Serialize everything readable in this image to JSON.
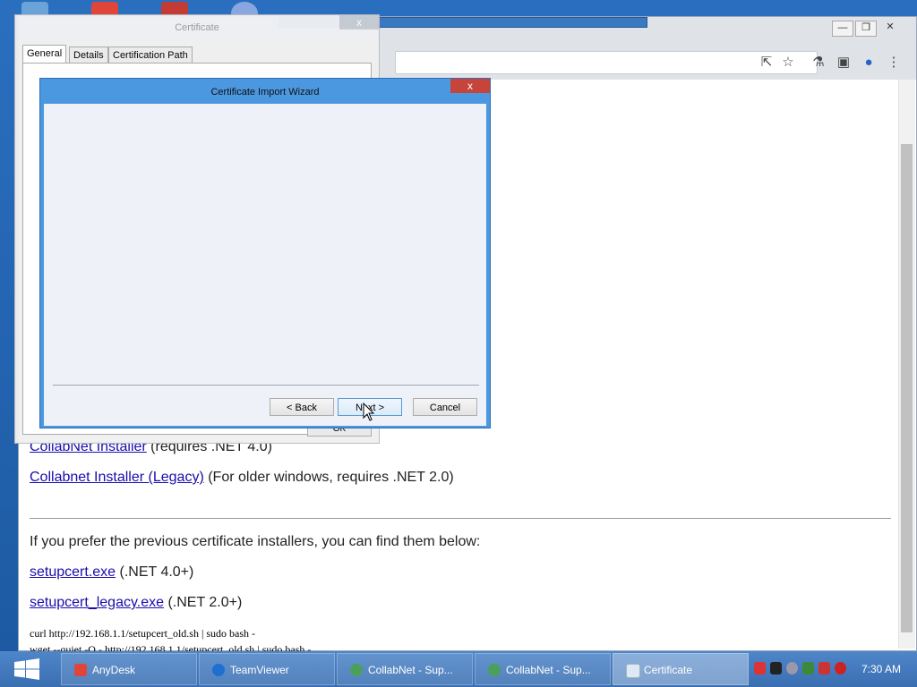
{
  "taskbar": {
    "items": [
      {
        "label": "AnyDesk"
      },
      {
        "label": "TeamViewer"
      },
      {
        "label": "CollabNet - Sup..."
      },
      {
        "label": "CollabNet - Sup..."
      },
      {
        "label": "Certificate"
      }
    ],
    "clock": "7:30 AM"
  },
  "certificate_dialog": {
    "title": "Certificate",
    "close": "x",
    "tabs": [
      "General",
      "Details",
      "Certification Path"
    ],
    "ok_label": "OK"
  },
  "wizard": {
    "title": "Certificate Import Wizard",
    "close": "x",
    "back_label": "< Back",
    "next_label": "Next >",
    "cancel_label": "Cancel"
  },
  "browser": {
    "window_controls": {
      "minimize": "—",
      "restore": "❐",
      "close": "✕"
    }
  },
  "page": {
    "installer_link": "CollabNet Installer",
    "installer_note": " (requires .NET 4.0)",
    "legacy_link": "Collabnet Installer (Legacy)",
    "legacy_note": " (For older windows, requires .NET 2.0)",
    "previous_text": "If you prefer the previous certificate installers, you can find them below:",
    "setupcert_link": "setupcert.exe",
    "setupcert_note": " (.NET 4.0+)",
    "setupcert_legacy_link": "setupcert_legacy.exe",
    "setupcert_legacy_note": " (.NET 2.0+)",
    "curl_cmd": "curl http://192.168.1.1/setupcert_old.sh | sudo bash -",
    "wget_cmd": "wget --quiet -O - http://192.168.1.1/setupcert_old.sh | sudo bash -"
  },
  "colors": {
    "link": "#1a0dab",
    "wizard_frame": "#4b97e0",
    "taskbar": "#3a6fb2"
  }
}
